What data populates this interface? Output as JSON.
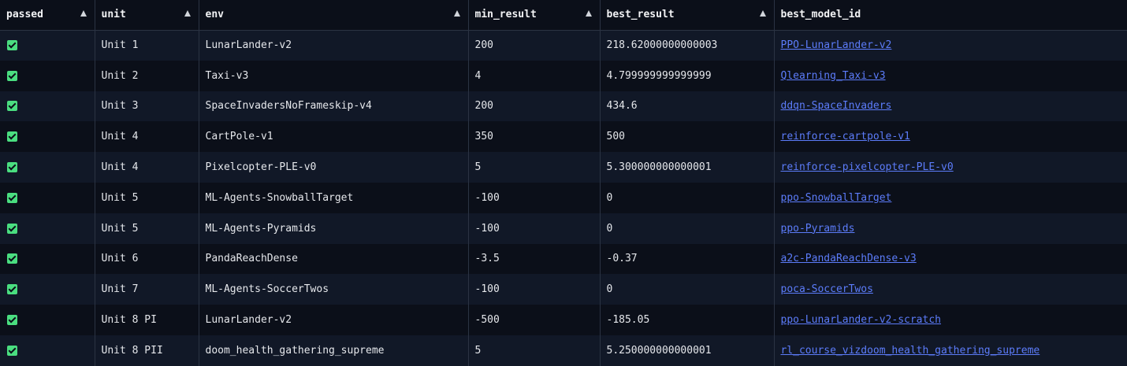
{
  "table": {
    "headers": [
      "passed",
      "unit",
      "env",
      "min_result",
      "best_result",
      "best_model_id"
    ],
    "rows": [
      {
        "passed": true,
        "unit": "Unit 1",
        "env": "LunarLander-v2",
        "min_result": "200",
        "best_result": "218.62000000000003",
        "best_model_id": "PPO-LunarLander-v2"
      },
      {
        "passed": true,
        "unit": "Unit 2",
        "env": "Taxi-v3",
        "min_result": "4",
        "best_result": "4.799999999999999",
        "best_model_id": "Qlearning_Taxi-v3"
      },
      {
        "passed": true,
        "unit": "Unit 3",
        "env": "SpaceInvadersNoFrameskip-v4",
        "min_result": "200",
        "best_result": "434.6",
        "best_model_id": "ddqn-SpaceInvaders"
      },
      {
        "passed": true,
        "unit": "Unit 4",
        "env": "CartPole-v1",
        "min_result": "350",
        "best_result": "500",
        "best_model_id": "reinforce-cartpole-v1"
      },
      {
        "passed": true,
        "unit": "Unit 4",
        "env": "Pixelcopter-PLE-v0",
        "min_result": "5",
        "best_result": "5.300000000000001",
        "best_model_id": "reinforce-pixelcopter-PLE-v0"
      },
      {
        "passed": true,
        "unit": "Unit 5",
        "env": "ML-Agents-SnowballTarget",
        "min_result": "-100",
        "best_result": "0",
        "best_model_id": "ppo-SnowballTarget"
      },
      {
        "passed": true,
        "unit": "Unit 5",
        "env": "ML-Agents-Pyramids",
        "min_result": "-100",
        "best_result": "0",
        "best_model_id": "ppo-Pyramids"
      },
      {
        "passed": true,
        "unit": "Unit 6",
        "env": "PandaReachDense",
        "min_result": "-3.5",
        "best_result": "-0.37",
        "best_model_id": "a2c-PandaReachDense-v3"
      },
      {
        "passed": true,
        "unit": "Unit 7",
        "env": "ML-Agents-SoccerTwos",
        "min_result": "-100",
        "best_result": "0",
        "best_model_id": "poca-SoccerTwos"
      },
      {
        "passed": true,
        "unit": "Unit 8 PI",
        "env": "LunarLander-v2",
        "min_result": "-500",
        "best_result": "-185.05",
        "best_model_id": "ppo-LunarLander-v2-scratch"
      },
      {
        "passed": true,
        "unit": "Unit 8 PII",
        "env": "doom_health_gathering_supreme",
        "min_result": "5",
        "best_result": "5.250000000000001",
        "best_model_id": "rl_course_vizdoom_health_gathering_supreme"
      }
    ]
  },
  "icons": {
    "passed": "check-icon",
    "sort": "sort-ascending-icon"
  },
  "colors": {
    "background": "#0b0f19",
    "row_alt": "#111827",
    "check": "#4ade80",
    "link": "#5c7cfa"
  }
}
